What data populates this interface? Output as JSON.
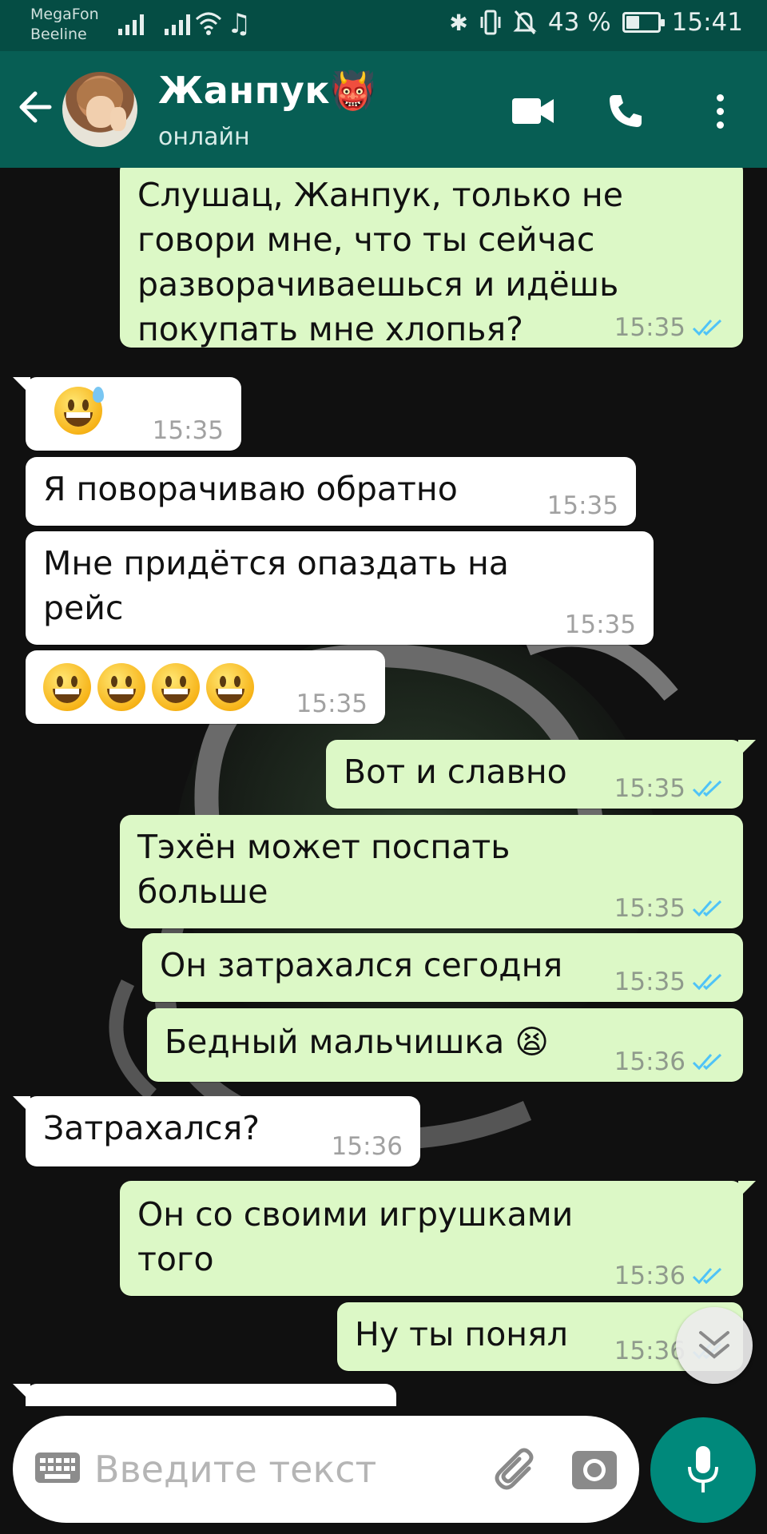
{
  "status_bar": {
    "carrier_1": "MegaFon",
    "carrier_2": "Beeline",
    "battery": "43 %",
    "battery_level": 0.43,
    "time": "15:41"
  },
  "header": {
    "contact_name": "Жанпук👹",
    "contact_status": "онлайн"
  },
  "messages": [
    {
      "dir": "out",
      "text": "Слушац, Жанпук, только не\nговори мне, что ты сейчас\nразворачиваешься и идёшь\nпокупать мне хлопья?",
      "time": "15:35",
      "read": true
    },
    {
      "dir": "in",
      "text": "😅",
      "time": "15:35"
    },
    {
      "dir": "in",
      "text": "Я поворачиваю обратно",
      "time": "15:35"
    },
    {
      "dir": "in",
      "text": "Мне придётся опаздать на\nрейс",
      "time": "15:35"
    },
    {
      "dir": "in",
      "text": "😀😀😀😀",
      "time": "15:35"
    },
    {
      "dir": "out",
      "text": "Вот и славно",
      "time": "15:35",
      "read": true
    },
    {
      "dir": "out",
      "text": "Тэхён может поспать\nбольше",
      "time": "15:35",
      "read": true
    },
    {
      "dir": "out",
      "text": "Он затрахался сегодня",
      "time": "15:35",
      "read": true
    },
    {
      "dir": "out",
      "text": "Бедный мальчишка 😫",
      "time": "15:36",
      "read": true
    },
    {
      "dir": "in",
      "text": "Затрахался?",
      "time": "15:36"
    },
    {
      "dir": "out",
      "text": "Он со своими игрушками\nтого",
      "time": "15:36",
      "read": true
    },
    {
      "dir": "out",
      "text": "Ну ты понял",
      "time": "15:36",
      "read": true
    }
  ],
  "input": {
    "placeholder": "Введите текст"
  },
  "colors": {
    "header": "#075e54",
    "status_bar": "#054d44",
    "outgoing_bubble": "#dcf8c6",
    "incoming_bubble": "#ffffff",
    "read_ticks": "#4fc3f7",
    "fab": "#00897b"
  },
  "icons": {
    "back": "arrow-left-icon",
    "video": "video-camera-icon",
    "call": "phone-icon",
    "menu": "more-vert-icon",
    "keyboard": "keyboard-icon",
    "attach": "paperclip-icon",
    "camera": "camera-icon",
    "mic": "microphone-icon",
    "scroll": "chevron-double-down-icon"
  }
}
